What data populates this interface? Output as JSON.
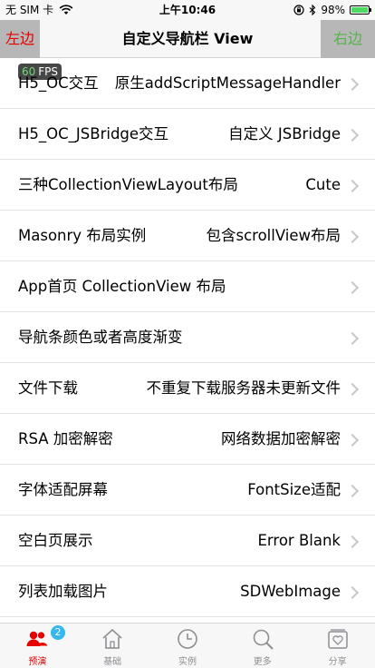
{
  "status_bar": {
    "carrier": "无 SIM 卡",
    "time": "上午10:46",
    "battery_percent": "98%",
    "battery_level": 0.98
  },
  "nav_bar": {
    "left_label": "左边",
    "title": "自定义导航栏 View",
    "right_label": "右边"
  },
  "fps": {
    "value": "60",
    "unit": "FPS"
  },
  "list": {
    "rows": [
      {
        "title": "H5_OC交互",
        "detail": "原生addScriptMessageHandler"
      },
      {
        "title": "H5_OC_JSBridge交互",
        "detail": "自定义 JSBridge"
      },
      {
        "title": "三种CollectionViewLayout布局",
        "detail": "Cute"
      },
      {
        "title": "Masonry 布局实例",
        "detail": "包含scrollView布局"
      },
      {
        "title": "App首页 CollectionView 布局",
        "detail": ""
      },
      {
        "title": "导航条颜色或者高度渐变",
        "detail": ""
      },
      {
        "title": "文件下载",
        "detail": "不重复下载服务器未更新文件"
      },
      {
        "title": "RSA 加密解密",
        "detail": "网络数据加密解密"
      },
      {
        "title": "字体适配屏幕",
        "detail": "FontSize适配"
      },
      {
        "title": "空白页展示",
        "detail": "Error Blank"
      },
      {
        "title": "列表加载图片",
        "detail": "SDWebImage"
      }
    ]
  },
  "tab_bar": {
    "tabs": [
      {
        "label": "预演",
        "icon": "people-icon",
        "badge": "2",
        "active": true
      },
      {
        "label": "基础",
        "icon": "house-icon",
        "active": false
      },
      {
        "label": "实例",
        "icon": "clock-icon",
        "active": false
      },
      {
        "label": "更多",
        "icon": "search-icon",
        "active": false
      },
      {
        "label": "分享",
        "icon": "heart-box-icon",
        "active": false
      }
    ]
  },
  "colors": {
    "left_button_text": "#e60000",
    "right_button_text": "#56b24c",
    "active_tab": "#e60000",
    "badge": "#35b8f0",
    "battery_fill": "#4cd964"
  }
}
